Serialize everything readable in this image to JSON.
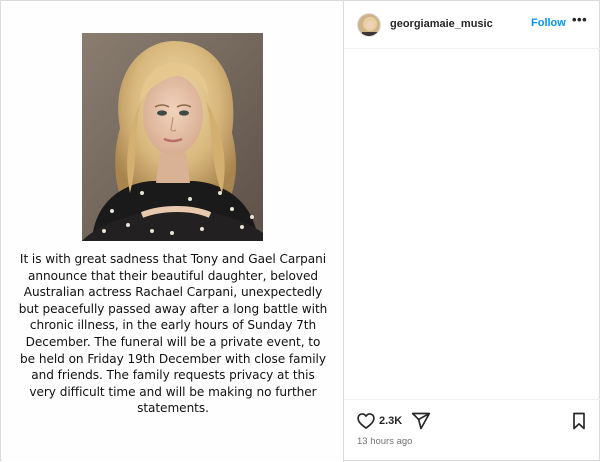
{
  "post": {
    "caption": "It is with great sadness that Tony and Gael Carpani announce that their beautiful daughter, beloved Australian actress Rachael Carpani, unexpectedly but peacefully passed away after a long battle with chronic illness, in the early hours of Sunday 7th December. The funeral will be a private event, to be held on Friday 19th December with close family and friends. The family requests privacy at this very difficult time and will be making no further statements."
  },
  "header": {
    "username": "georgiamaie_music",
    "follow_label": "Follow",
    "more_label": "•••"
  },
  "actions": {
    "like_count": "2.3K",
    "timestamp": "13 hours ago"
  },
  "icons": {
    "like": "heart-icon",
    "share": "share-icon",
    "save": "bookmark-icon",
    "more": "more-options-icon"
  },
  "colors": {
    "follow": "#0095f6",
    "border": "#dbdbdb",
    "text": "#262626",
    "muted": "#737373"
  }
}
